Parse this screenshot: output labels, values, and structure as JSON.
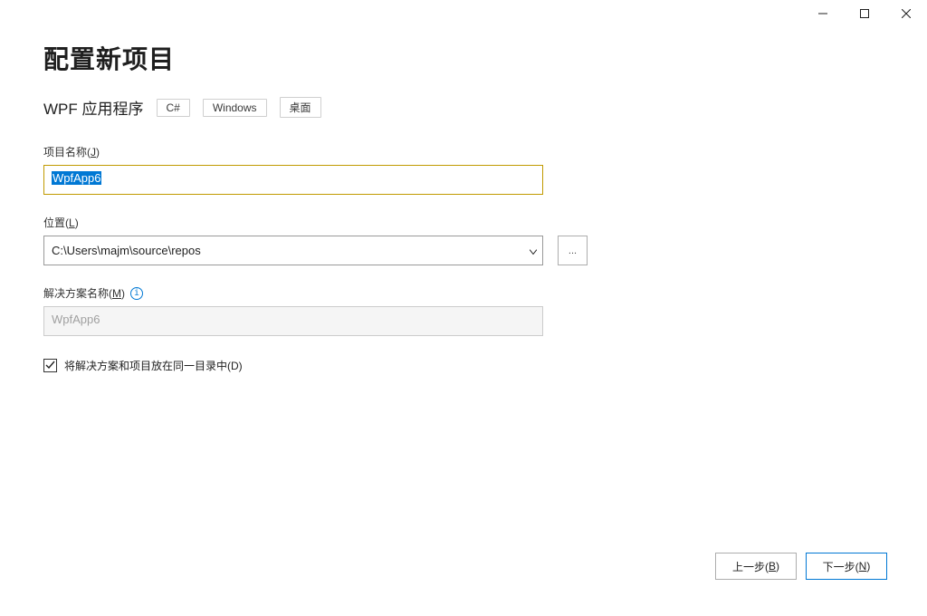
{
  "window": {
    "title_icons": {
      "minimize": "—",
      "maximize": "▢",
      "close": "✕"
    }
  },
  "page": {
    "title": "配置新项目",
    "subtitle": "WPF 应用程序",
    "tags": [
      "C#",
      "Windows",
      "桌面"
    ]
  },
  "fields": {
    "project_name": {
      "label_pre": "项目名称(",
      "hotkey": "J",
      "label_post": ")",
      "value": "WpfApp6"
    },
    "location": {
      "label_pre": "位置(",
      "hotkey": "L",
      "label_post": ")",
      "value": "C:\\Users\\majm\\source\\repos",
      "browse": "..."
    },
    "solution": {
      "label_pre": "解决方案名称(",
      "hotkey": "M",
      "label_post": ")",
      "info": "i",
      "placeholder": "WpfApp6"
    },
    "same_dir": {
      "checked": true,
      "label_pre": "将解决方案和项目放在同一目录中(",
      "hotkey": "D",
      "label_post": ")"
    }
  },
  "footer": {
    "back_pre": "上一步(",
    "back_hk": "B",
    "back_post": ")",
    "next_pre": "下一步(",
    "next_hk": "N",
    "next_post": ")"
  }
}
